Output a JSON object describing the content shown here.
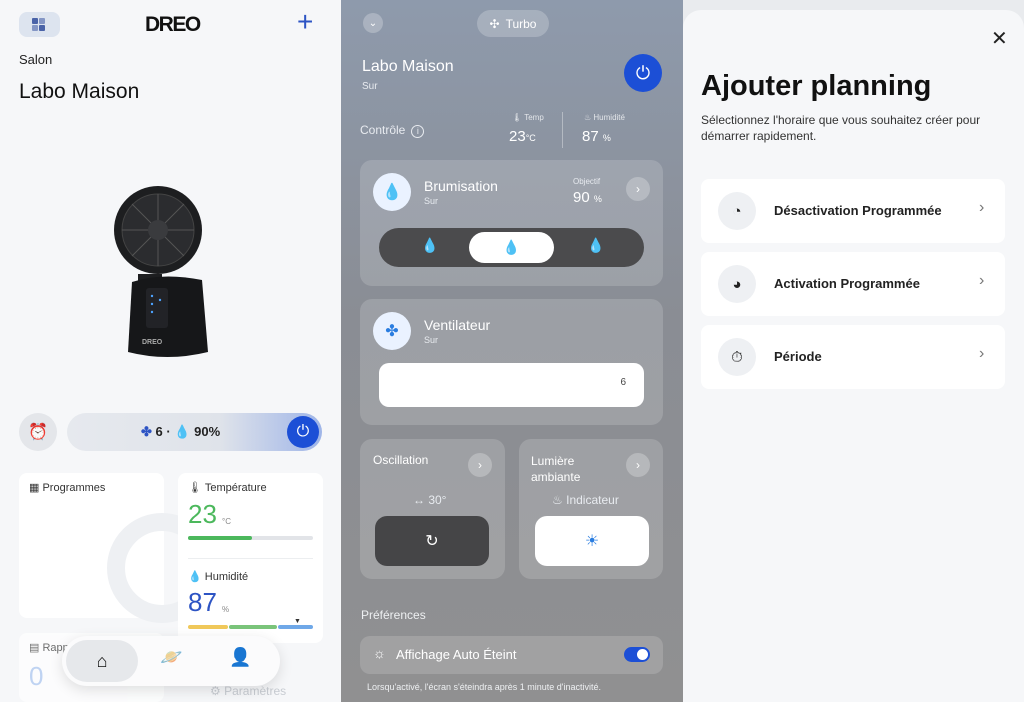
{
  "panel1": {
    "logo": "DREO",
    "room": "Salon",
    "device_name": "Labo Maison",
    "status": {
      "fan_level": "6 ·",
      "humidity": "90%"
    },
    "cards": {
      "programmes": {
        "label": "Programmes"
      },
      "temperature": {
        "label": "Température",
        "value": "23",
        "unit": "°C"
      },
      "humidity": {
        "label": "Humidité",
        "value": "87",
        "unit": "%"
      },
      "rapport": {
        "label": "Rapp",
        "value": "0"
      },
      "parametres": {
        "label": "Paramètres"
      }
    }
  },
  "panel2": {
    "mode": "Turbo",
    "device_name": "Labo Maison",
    "state": "Sur",
    "control_label": "Contrôle",
    "temp": {
      "label": "Temp",
      "value": "23",
      "unit": "°C"
    },
    "humidity": {
      "label": "Humidité",
      "value": "87",
      "unit": "%"
    },
    "brumisation": {
      "title": "Brumisation",
      "state": "Sur",
      "target_label": "Objectif",
      "target_value": "90",
      "target_unit": "%"
    },
    "ventilateur": {
      "title": "Ventilateur",
      "state": "Sur",
      "level": "6"
    },
    "oscillation": {
      "title": "Oscillation",
      "angle": "↔ 30°"
    },
    "lumiere": {
      "title": "Lumière ambiante",
      "mode": "Indicateur"
    },
    "preferences_label": "Préférences",
    "auto_off": {
      "label": "Affichage Auto Éteint",
      "enabled": true
    },
    "note": "Lorsqu'activé, l'écran s'éteindra après 1 minute d'inactivité."
  },
  "panel3": {
    "title": "Ajouter planning",
    "description": "Sélectionnez l'horaire que vous souhaitez créer pour démarrer rapidement.",
    "options": [
      {
        "label": "Désactivation Programmée",
        "icon": "off-clock-icon"
      },
      {
        "label": "Activation Programmée",
        "icon": "on-clock-icon"
      },
      {
        "label": "Période",
        "icon": "timer-icon"
      }
    ]
  },
  "colors": {
    "accent": "#1c4fd6",
    "temp_green": "#4cb85c",
    "humidity_blue": "#2d54c4"
  }
}
